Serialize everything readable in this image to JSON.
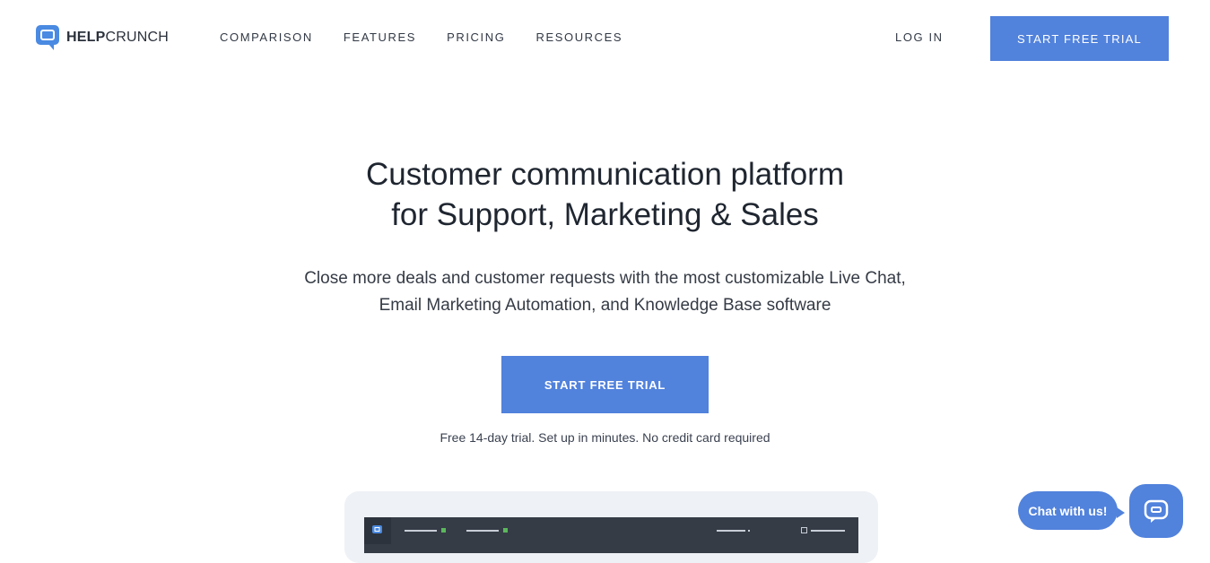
{
  "brand": {
    "logo_bold": "HELP",
    "logo_light": "CRUNCH",
    "accent": "#5182dc"
  },
  "nav": {
    "links": [
      "COMPARISON",
      "FEATURES",
      "PRICING",
      "RESOURCES"
    ],
    "login": "LOG IN",
    "cta": "START FREE TRIAL"
  },
  "hero": {
    "title_line1": "Customer communication platform",
    "title_line2": "for Support, Marketing & Sales",
    "subtitle_line1": "Close more deals and customer requests with the most customizable Live Chat,",
    "subtitle_line2": "Email Marketing Automation, and Knowledge Base software",
    "cta": "START FREE TRIAL",
    "note": "Free 14-day trial. Set up in minutes. No credit card required"
  },
  "chat_widget": {
    "label": "Chat with us!",
    "icon": "chat-bubble-icon"
  }
}
